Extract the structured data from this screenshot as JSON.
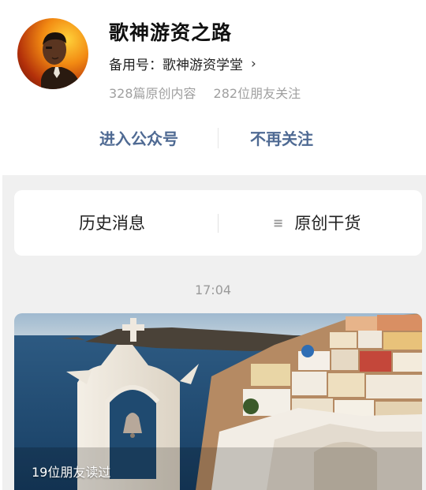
{
  "profile": {
    "name": "歌神游资之路",
    "alias_label": "备用号：歌神游资学堂",
    "alias_chevron": "›",
    "original_count": "328篇原创内容",
    "friends_follow": "282位朋友关注"
  },
  "actions": {
    "enter": "进入公众号",
    "unfollow": "不再关注"
  },
  "menu": {
    "history": "历史消息",
    "original_icon": "≡",
    "original": "原创干货"
  },
  "feed": {
    "time": "17:04",
    "article": {
      "read_count": "19位朋友读过"
    }
  }
}
